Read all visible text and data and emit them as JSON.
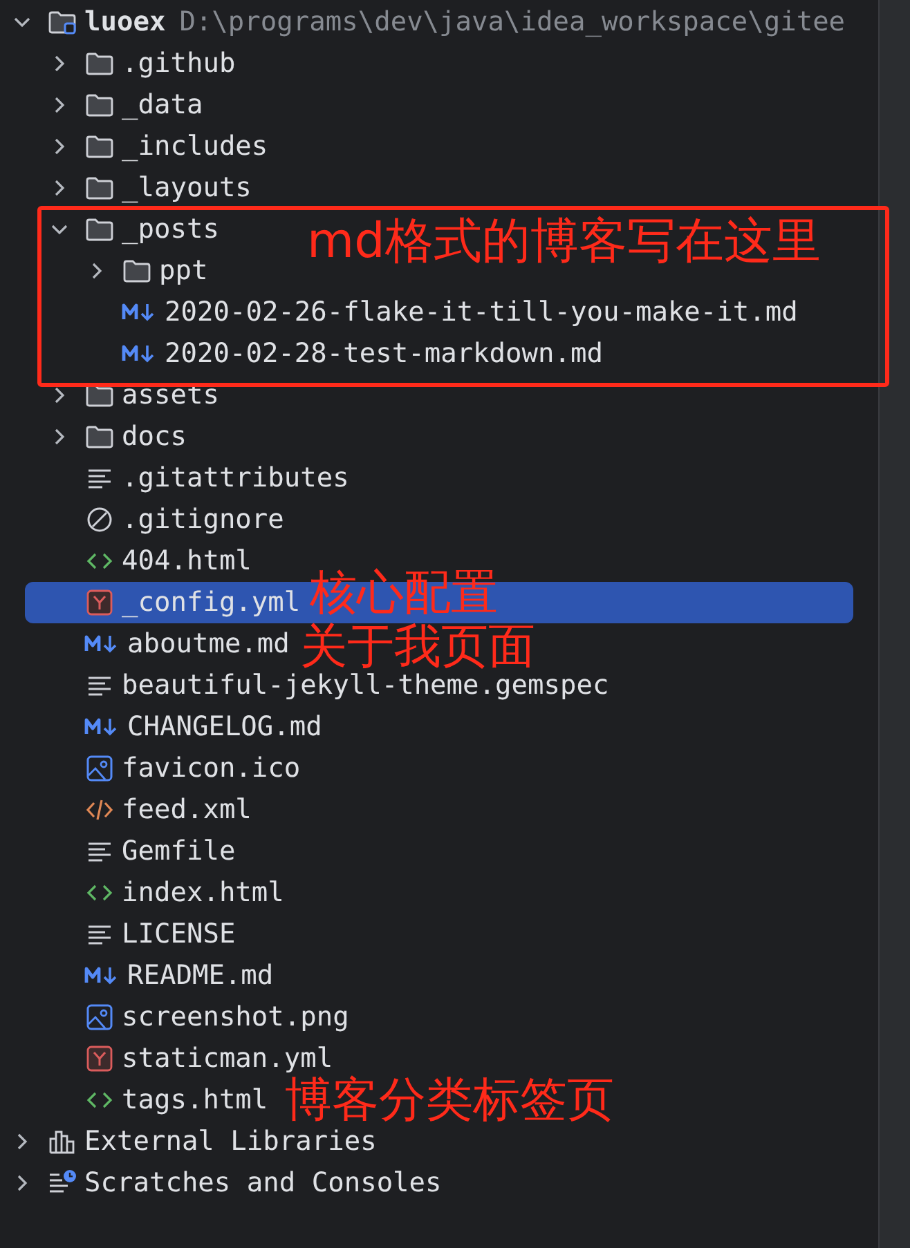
{
  "tree": [
    {
      "label": "luoex",
      "path": "D:\\programs\\dev\\java\\idea_workspace\\gitee",
      "kind": "project",
      "expanded": true,
      "selected": false,
      "children": [
        {
          "label": ".github",
          "kind": "folder",
          "expanded": false,
          "selected": false
        },
        {
          "label": "_data",
          "kind": "folder",
          "expanded": false,
          "selected": false
        },
        {
          "label": "_includes",
          "kind": "folder",
          "expanded": false,
          "selected": false
        },
        {
          "label": "_layouts",
          "kind": "folder",
          "expanded": false,
          "selected": false
        },
        {
          "label": "_posts",
          "kind": "folder",
          "expanded": true,
          "selected": false,
          "children": [
            {
              "label": "ppt",
              "kind": "folder",
              "expanded": false,
              "selected": false
            },
            {
              "label": "2020-02-26-flake-it-till-you-make-it.md",
              "kind": "markdown",
              "selected": false
            },
            {
              "label": "2020-02-28-test-markdown.md",
              "kind": "markdown",
              "selected": false
            }
          ]
        },
        {
          "label": "assets",
          "kind": "folder",
          "expanded": false,
          "selected": false
        },
        {
          "label": "docs",
          "kind": "folder",
          "expanded": false,
          "selected": false
        },
        {
          "label": ".gitattributes",
          "kind": "text",
          "selected": false
        },
        {
          "label": ".gitignore",
          "kind": "ignore",
          "selected": false
        },
        {
          "label": "404.html",
          "kind": "html",
          "selected": false
        },
        {
          "label": "_config.yml",
          "kind": "yaml",
          "selected": true
        },
        {
          "label": "aboutme.md",
          "kind": "markdown",
          "selected": false
        },
        {
          "label": "beautiful-jekyll-theme.gemspec",
          "kind": "text",
          "selected": false
        },
        {
          "label": "CHANGELOG.md",
          "kind": "markdown",
          "selected": false
        },
        {
          "label": "favicon.ico",
          "kind": "image",
          "selected": false
        },
        {
          "label": "feed.xml",
          "kind": "xml",
          "selected": false
        },
        {
          "label": "Gemfile",
          "kind": "text",
          "selected": false
        },
        {
          "label": "index.html",
          "kind": "html",
          "selected": false
        },
        {
          "label": "LICENSE",
          "kind": "text",
          "selected": false
        },
        {
          "label": "README.md",
          "kind": "markdown",
          "selected": false
        },
        {
          "label": "screenshot.png",
          "kind": "image",
          "selected": false
        },
        {
          "label": "staticman.yml",
          "kind": "yaml",
          "selected": false
        },
        {
          "label": "tags.html",
          "kind": "html",
          "selected": false
        }
      ]
    },
    {
      "label": "External Libraries",
      "kind": "libraries",
      "expanded": false,
      "selected": false
    },
    {
      "label": "Scratches and Consoles",
      "kind": "scratches",
      "expanded": false,
      "selected": false
    }
  ],
  "annotations": [
    {
      "text": "md格式的博客写在这里"
    },
    {
      "text": "核心配置"
    },
    {
      "text": "关于我页面"
    },
    {
      "text": "博客分类标签页"
    }
  ]
}
